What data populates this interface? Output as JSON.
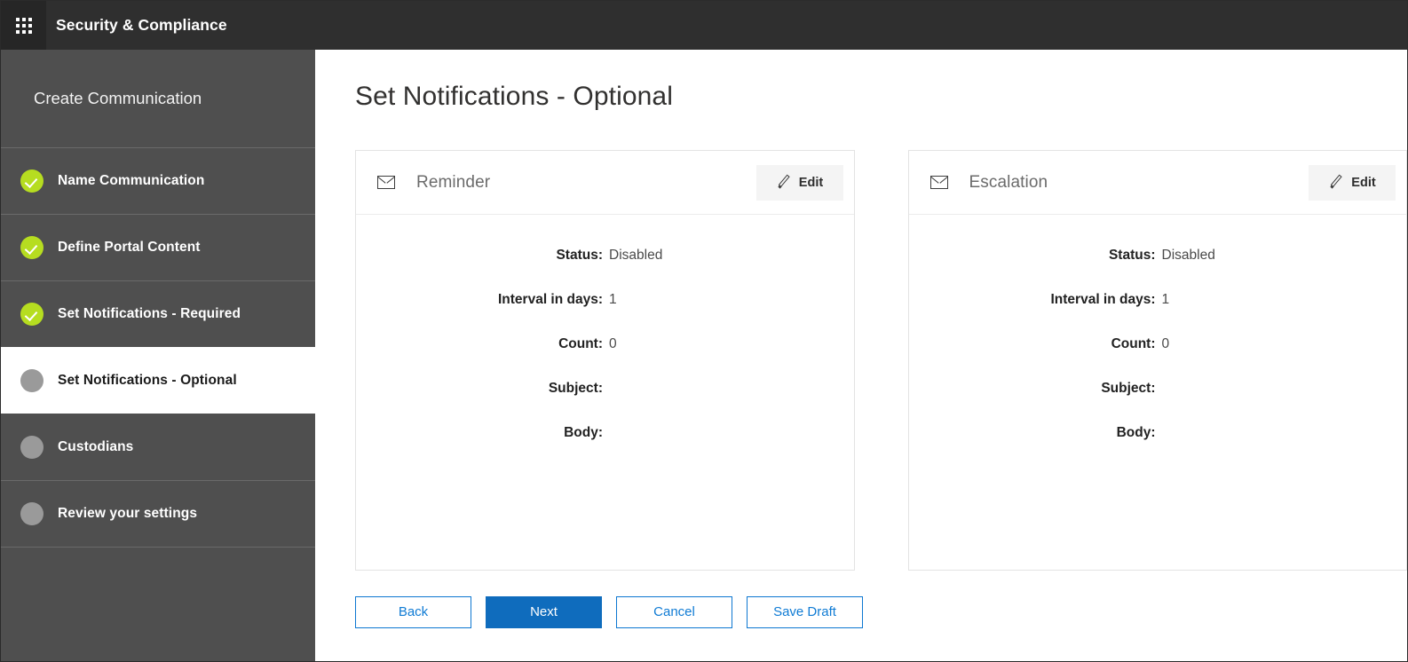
{
  "topbar": {
    "waffle_icon": "app-launcher-grid-icon",
    "title": "Security & Compliance"
  },
  "sidebar": {
    "heading": "Create Communication",
    "items": [
      {
        "label": "Name Communication",
        "state": "done"
      },
      {
        "label": "Define Portal Content",
        "state": "done"
      },
      {
        "label": "Set Notifications - Required",
        "state": "done"
      },
      {
        "label": "Set Notifications - Optional",
        "state": "active"
      },
      {
        "label": "Custodians",
        "state": "pending"
      },
      {
        "label": "Review your settings",
        "state": "pending"
      }
    ]
  },
  "main": {
    "page_title": "Set Notifications - Optional",
    "cards": [
      {
        "icon": "envelope-icon",
        "title": "Reminder",
        "edit_label": "Edit",
        "fields": [
          {
            "label": "Status:",
            "value": "Disabled"
          },
          {
            "label": "Interval in days:",
            "value": "1"
          },
          {
            "label": "Count:",
            "value": "0"
          },
          {
            "label": "Subject:",
            "value": ""
          },
          {
            "label": "Body:",
            "value": ""
          }
        ]
      },
      {
        "icon": "envelope-icon",
        "title": "Escalation",
        "edit_label": "Edit",
        "fields": [
          {
            "label": "Status:",
            "value": "Disabled"
          },
          {
            "label": "Interval in days:",
            "value": "1"
          },
          {
            "label": "Count:",
            "value": "0"
          },
          {
            "label": "Subject:",
            "value": ""
          },
          {
            "label": "Body:",
            "value": ""
          }
        ]
      }
    ],
    "actions": [
      {
        "label": "Back",
        "style": "secondary"
      },
      {
        "label": "Next",
        "style": "primary"
      },
      {
        "label": "Cancel",
        "style": "secondary"
      },
      {
        "label": "Save Draft",
        "style": "secondary"
      }
    ]
  },
  "colors": {
    "topbar_bg": "#2f2f2f",
    "sidebar_bg": "#4f4f4f",
    "accent_green": "#b6dd20",
    "pending_gray": "#9a9a9a",
    "primary_blue": "#0f6cbd",
    "link_blue": "#0f7bd4"
  }
}
